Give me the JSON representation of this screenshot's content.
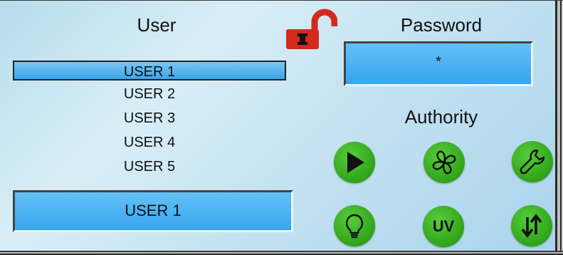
{
  "header": {
    "user_title": "User",
    "password_title": "Password",
    "authority_title": "Authority"
  },
  "users": {
    "items": [
      "USER 1",
      "USER 2",
      "USER 3",
      "USER 4",
      "USER 5"
    ],
    "selected_index": 0,
    "selected_value": "USER 1"
  },
  "password": {
    "value": "*"
  },
  "lock": {
    "icon": "unlocked-padlock-icon",
    "color": "#d42a1c"
  },
  "authority": {
    "buttons": [
      {
        "icon": "play-icon"
      },
      {
        "icon": "fan-icon"
      },
      {
        "icon": "wrench-icon"
      },
      {
        "icon": "lightbulb-icon"
      },
      {
        "icon": "uv-icon",
        "label": "UV"
      },
      {
        "icon": "sort-arrows-icon"
      }
    ],
    "button_color": "#2fa419"
  }
}
